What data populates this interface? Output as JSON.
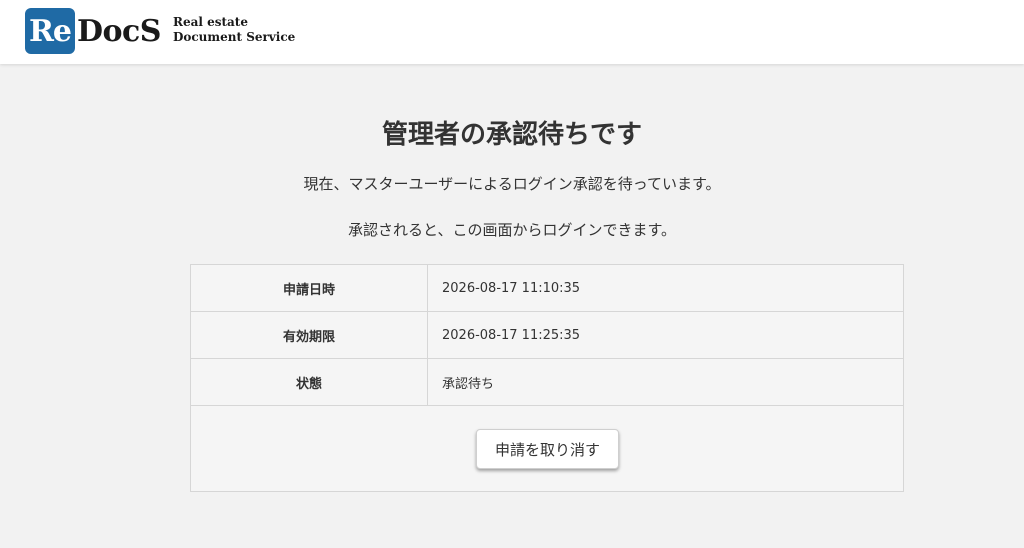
{
  "colors": {
    "brand": "#1f6aa5",
    "background": "#f2f2f2",
    "header_background": "#ffffff"
  },
  "header": {
    "logo": {
      "mark_text": "Re",
      "word_text": "DocS",
      "tagline_line1": "Real estate",
      "tagline_line2": "Document Service"
    }
  },
  "main": {
    "title": "管理者の承認待ちです",
    "message_line1": "現在、マスターユーザーによるログイン承認を待っています。",
    "message_line2": "承認されると、この画面からログインできます。"
  },
  "info_table": {
    "rows": [
      {
        "label": "申請日時",
        "value": "2026-08-17 11:10:35"
      },
      {
        "label": "有効期限",
        "value": "2026-08-17 11:25:35"
      },
      {
        "label": "状態",
        "value": "承認待ち"
      }
    ],
    "cancel_button_label": "申請を取り消す"
  }
}
